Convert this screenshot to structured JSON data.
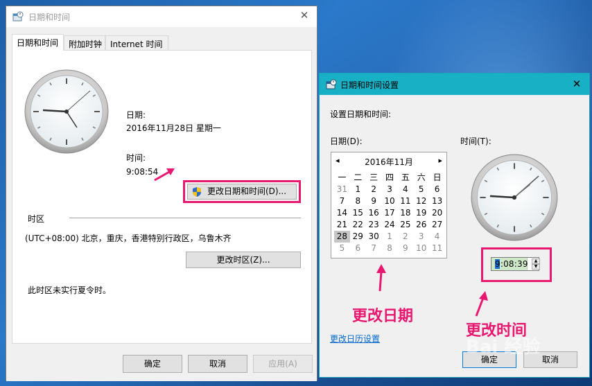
{
  "colors": {
    "accent": "#17b0c4",
    "highlight": "#e8176f",
    "link": "#0066cc"
  },
  "window1": {
    "title": "日期和时间",
    "tabs": [
      {
        "label": "日期和时间",
        "active": true
      },
      {
        "label": "附加时钟",
        "active": false
      },
      {
        "label": "Internet 时间",
        "active": false
      }
    ],
    "date_label": "日期:",
    "date_value": "2016年11月28日 星期一",
    "time_label": "时间:",
    "time_value": "9:08:54",
    "change_datetime_button": "更改日期和时间(D)...",
    "timezone_heading": "时区",
    "timezone_value": "(UTC+08:00) 北京，重庆，香港特别行政区，乌鲁木齐",
    "change_timezone_button": "更改时区(Z)...",
    "dst_note": "此时区未实行夏令时。",
    "buttons": {
      "ok": "确定",
      "cancel": "取消",
      "apply": "应用(A)"
    }
  },
  "window2": {
    "title": "日期和时间设置",
    "instruction": "设置日期和时间:",
    "date_label": "日期(D):",
    "time_label": "时间(T):",
    "calendar": {
      "month_title": "2016年11月",
      "prev": "◂",
      "next": "▸",
      "weekdays": [
        "一",
        "二",
        "三",
        "四",
        "五",
        "六",
        "日"
      ],
      "weeks": [
        [
          {
            "d": "31",
            "o": true
          },
          {
            "d": "1"
          },
          {
            "d": "2"
          },
          {
            "d": "3"
          },
          {
            "d": "4"
          },
          {
            "d": "5"
          },
          {
            "d": "6"
          }
        ],
        [
          {
            "d": "7"
          },
          {
            "d": "8"
          },
          {
            "d": "9"
          },
          {
            "d": "10"
          },
          {
            "d": "11"
          },
          {
            "d": "12"
          },
          {
            "d": "13"
          }
        ],
        [
          {
            "d": "14"
          },
          {
            "d": "15"
          },
          {
            "d": "16"
          },
          {
            "d": "17"
          },
          {
            "d": "18"
          },
          {
            "d": "19"
          },
          {
            "d": "20"
          }
        ],
        [
          {
            "d": "21"
          },
          {
            "d": "22"
          },
          {
            "d": "23"
          },
          {
            "d": "24"
          },
          {
            "d": "25"
          },
          {
            "d": "26"
          },
          {
            "d": "27"
          }
        ],
        [
          {
            "d": "28",
            "s": true
          },
          {
            "d": "29"
          },
          {
            "d": "30"
          },
          {
            "d": "1",
            "o": true
          },
          {
            "d": "2",
            "o": true
          },
          {
            "d": "3",
            "o": true
          },
          {
            "d": "4",
            "o": true
          }
        ],
        [
          {
            "d": "5",
            "o": true
          },
          {
            "d": "6",
            "o": true
          },
          {
            "d": "7",
            "o": true
          },
          {
            "d": "8",
            "o": true
          },
          {
            "d": "9",
            "o": true
          },
          {
            "d": "10",
            "o": true
          },
          {
            "d": "11",
            "o": true
          }
        ]
      ]
    },
    "time_value": "9:08:39",
    "calendar_settings_link": "更改日历设置",
    "buttons": {
      "ok": "确定",
      "cancel": "取消"
    }
  },
  "annotations": {
    "change_date": "更改日期",
    "change_time": "更改时间"
  },
  "watermark": "Bai 经验"
}
